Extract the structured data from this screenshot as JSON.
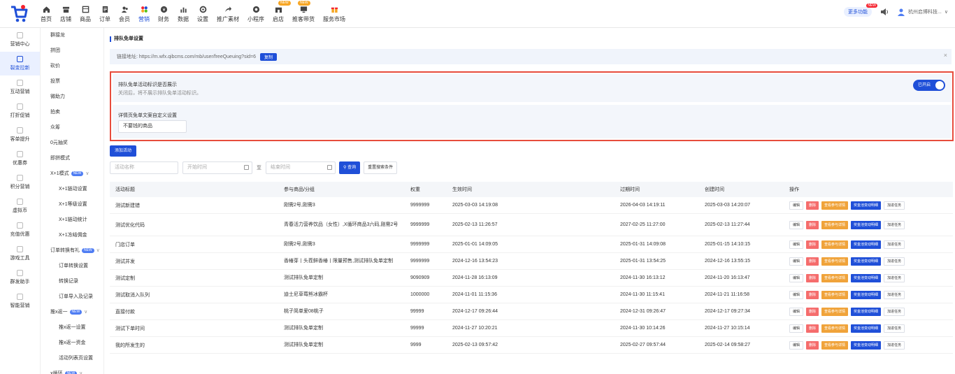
{
  "nav": [
    {
      "label": "首页",
      "icon": "home-icon"
    },
    {
      "label": "店铺",
      "icon": "store-icon"
    },
    {
      "label": "商品",
      "icon": "goods-icon"
    },
    {
      "label": "订单",
      "icon": "order-icon"
    },
    {
      "label": "会员",
      "icon": "member-icon"
    },
    {
      "label": "营销",
      "icon": "marketing-icon",
      "active": true
    },
    {
      "label": "财务",
      "icon": "finance-icon"
    },
    {
      "label": "数据",
      "icon": "data-icon"
    },
    {
      "label": "设置",
      "icon": "settings-icon"
    },
    {
      "label": "推广素材",
      "icon": "share-icon"
    },
    {
      "label": "小程序",
      "icon": "miniprogram-icon"
    },
    {
      "label": "启店",
      "icon": "shop-icon",
      "badge": "NEW"
    },
    {
      "label": "推客带货",
      "icon": "monitor-icon",
      "badge": "NEW"
    },
    {
      "label": "服务市场",
      "icon": "gift-icon"
    }
  ],
  "topright": {
    "more_label": "更多功能",
    "more_badge": "NEW",
    "company": "杭州启博科技..."
  },
  "side1": [
    "营销中心",
    "裂变拉新",
    "互动营销",
    "打折促销",
    "客单提升",
    "优惠券",
    "积分营销",
    "虚拟币",
    "充值优惠",
    "游戏工具",
    "群发助手",
    "智能营销"
  ],
  "side1_active": 1,
  "side2": [
    {
      "label": "群接龙"
    },
    {
      "label": "拼团"
    },
    {
      "label": "砍价"
    },
    {
      "label": "投票"
    },
    {
      "label": "微助力"
    },
    {
      "label": "拍卖"
    },
    {
      "label": "众筹"
    },
    {
      "label": "0元抽奖"
    },
    {
      "label": "即拼模式"
    },
    {
      "label": "X+1模式",
      "badge": "NEW",
      "chev": "∨"
    },
    {
      "label": "X+1链动设置",
      "sub": true
    },
    {
      "label": "X+1等级设置",
      "sub": true
    },
    {
      "label": "X+1链动统计",
      "sub": true
    },
    {
      "label": "X+1冻结佣金",
      "sub": true
    },
    {
      "label": "订单转换有礼",
      "badge": "NEW",
      "chev": "∨"
    },
    {
      "label": "订单转换设置",
      "sub": true
    },
    {
      "label": "转换记录",
      "sub": true
    },
    {
      "label": "订单导入及记录",
      "sub": true
    },
    {
      "label": "推x返一",
      "badge": "NEW",
      "chev": "∨"
    },
    {
      "label": "推x返一设置",
      "sub": true
    },
    {
      "label": "推x返一资金",
      "sub": true
    },
    {
      "label": "活动列表页设置",
      "sub": true
    },
    {
      "label": "x循环",
      "badge": "NEW",
      "chev": "∨"
    }
  ],
  "page": {
    "title": "排队免单设置",
    "link_label": "链接地址:",
    "link_url": "https://m.wfx.qibcms.com/mb/user/freeQueuing?sid=6",
    "copy_label": "复制",
    "close": "×",
    "panel1_title": "排队免单活动标识是否展示",
    "panel1_desc": "关闭后，将不展示排队免单活动标识。",
    "toggle_label": "已开启",
    "panel2_title": "详情页免单文案自定义设置",
    "panel2_value": "不要钱的商品",
    "add_label": "添加活动",
    "filter_name_ph": "活动名称",
    "filter_start_ph": "开始时间",
    "filter_to": "至",
    "filter_end_ph": "结束时间",
    "query_label": "查询",
    "reset_label": "重置搜索条件"
  },
  "table": {
    "headers": [
      "活动标题",
      "参与商品/分组",
      "权重",
      "生效时间",
      "过期时间",
      "创建时间",
      "操作"
    ],
    "ops": [
      "编辑",
      "删除",
      "查看参与详情",
      "奖金池变动明细",
      "加进任务"
    ],
    "rows": [
      [
        "测试新建错",
        "刚需2号,刚需3",
        "9999999",
        "2025-03-03 14:19:08",
        "2026-04-03 14:19:11",
        "2025-03-03 14:20:07"
      ],
      [
        "测试优化代码",
        "青春活力营养饮品（女性）,X循环商品3六码,刚需2号",
        "9999999",
        "2025-02-13 11:26:57",
        "2027-02-25 11:27:00",
        "2025-02-13 11:27:44"
      ],
      [
        "门店订单",
        "刚需2号,刚需3",
        "9999999",
        "2025-01-01 14:09:05",
        "2025-01-31 14:09:08",
        "2025-01-15 14:10:15"
      ],
      [
        "测试并发",
        "香椿芽丨头茬鲜香椿丨限量预售,测试排队免单定制",
        "9999999",
        "2024-12-16 13:54:23",
        "2025-01-31 13:54:25",
        "2024-12-16 13:55:15"
      ],
      [
        "测试定制",
        "测试排队免单定制",
        "9090909",
        "2024-11-28 16:13:09",
        "2024-11-30 16:13:12",
        "2024-11-20 16:13:47"
      ],
      [
        "测试取消入队列",
        "迪士尼草莓熊冰霸杯",
        "1000000",
        "2024-11-01 11:15:36",
        "2024-11-30 11:15:41",
        "2024-11-21 11:16:58"
      ],
      [
        "直接付款",
        "桃子简单爱08桃子",
        "99999",
        "2024-12-17 09:26:44",
        "2024-12-31 09:26:47",
        "2024-12-17 09:27:34"
      ],
      [
        "测试下单时间",
        "测试排队免单定制",
        "99999",
        "2024-11-27 10:20:21",
        "2024-11-30 10:14:26",
        "2024-11-27 10:15:14"
      ],
      [
        "我的所发生的",
        "测试排队免单定制",
        "9999",
        "2025-02-13 09:57:42",
        "2025-02-27 09:57:44",
        "2025-02-14 09:58:27"
      ]
    ]
  },
  "colors": {
    "accent": "#1f4fd8",
    "danger": "#f56c6c",
    "warn": "#f0a33a",
    "highlight": "#e74c3c"
  }
}
